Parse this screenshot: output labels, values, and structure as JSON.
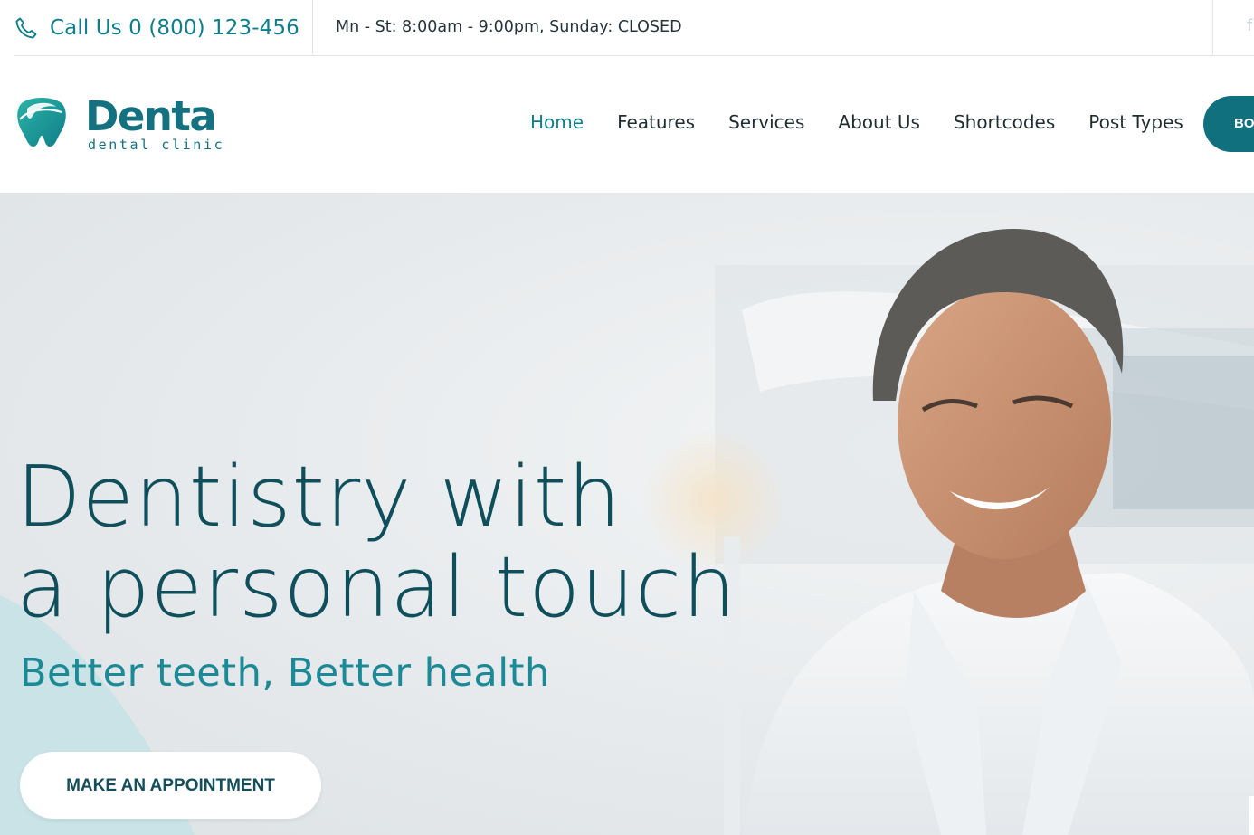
{
  "topbar": {
    "call_text": "Call Us 0 (800) 123-456",
    "hours_text": "Mn - St: 8:00am - 9:00pm, Sunday: CLOSED",
    "social_partial": "f"
  },
  "brand": {
    "name": "Denta",
    "tagline": "dental clinic"
  },
  "nav": {
    "items": [
      {
        "label": "Home",
        "active": true
      },
      {
        "label": "Features"
      },
      {
        "label": "Services"
      },
      {
        "label": "About Us"
      },
      {
        "label": "Shortcodes"
      },
      {
        "label": "Post Types"
      }
    ],
    "book_button_partial": "BO"
  },
  "hero": {
    "title_line1": "Dentistry with",
    "title_line2": "a personal touch",
    "subtitle": "Better teeth, Better health",
    "cta_label": "MAKE AN APPOINTMENT"
  },
  "colors": {
    "accent": "#0f7e8a",
    "dark_teal": "#0e4f5b",
    "button_bg": "#11707e",
    "light_blob": "#c9e3e6"
  },
  "icons": [
    "phone-icon",
    "tooth-logo-icon",
    "facebook-icon"
  ]
}
